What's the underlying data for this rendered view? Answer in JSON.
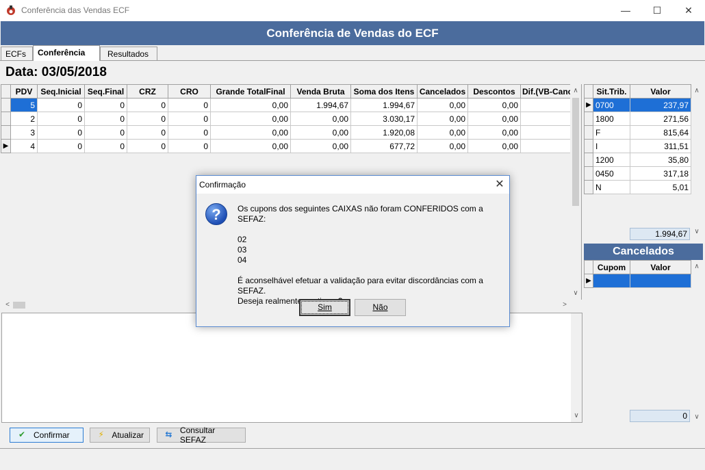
{
  "window": {
    "title": "Conferência das Vendas ECF",
    "minimize": "—",
    "maximize": "☐",
    "close": "✕"
  },
  "header": {
    "title": "Conferência de Vendas do ECF"
  },
  "tabs": [
    {
      "label": "ECFs"
    },
    {
      "label": "Conferência"
    },
    {
      "label": "Resultados"
    }
  ],
  "date_label": "Data: 03/05/2018",
  "main_grid": {
    "columns": [
      "PDV",
      "Seq.Inicial",
      "Seq.Final",
      "CRZ",
      "CRO",
      "Grande TotalFinal",
      "Venda Bruta",
      "Soma dos Itens",
      "Cancelados",
      "Descontos",
      "Dif.(VB-Canc"
    ],
    "rows": [
      [
        "5",
        "0",
        "0",
        "0",
        "0",
        "0,00",
        "1.994,67",
        "1.994,67",
        "0,00",
        "0,00",
        ""
      ],
      [
        "2",
        "0",
        "0",
        "0",
        "0",
        "0,00",
        "0,00",
        "3.030,17",
        "0,00",
        "0,00",
        ""
      ],
      [
        "3",
        "0",
        "0",
        "0",
        "0",
        "0,00",
        "0,00",
        "1.920,08",
        "0,00",
        "0,00",
        ""
      ],
      [
        "4",
        "0",
        "0",
        "0",
        "0",
        "0,00",
        "0,00",
        "677,72",
        "0,00",
        "0,00",
        ""
      ]
    ],
    "indicator_glyph": "▶"
  },
  "sit_grid": {
    "columns": [
      "Sit.Trib.",
      "Valor"
    ],
    "rows": [
      [
        "0700",
        "237,97"
      ],
      [
        "1800",
        "271,56"
      ],
      [
        "F",
        "815,64"
      ],
      [
        "I",
        "311,51"
      ],
      [
        "1200",
        "35,80"
      ],
      [
        "0450",
        "317,18"
      ],
      [
        "N",
        "5,01"
      ]
    ],
    "total": "1.994,67"
  },
  "cancel_panel": {
    "title": "Cancelados",
    "columns": [
      "Cupom",
      "Valor"
    ],
    "total": "0"
  },
  "buttons": {
    "confirmar": "Confirmar",
    "atualizar": "Atualizar",
    "consultar": "Consultar SEFAZ"
  },
  "icons": {
    "confirmar": "check-icon",
    "atualizar": "lightning-icon",
    "consultar": "arrows-icon"
  },
  "dialog": {
    "title": "Confirmação",
    "message_lines": [
      "Os cupons dos seguintes CAIXAS não foram CONFERIDOS com a SEFAZ:",
      "",
      "02",
      "03",
      "04",
      "",
      "É aconselhável efetuar a validação para evitar discordâncias com a SEFAZ.",
      "Deseja realmente continuar?"
    ],
    "yes_label": "Sim",
    "no_label": "Não",
    "icon_glyph": "?"
  },
  "colors": {
    "header_blue": "#4b6c9d",
    "selection_blue": "#1e6fd6",
    "total_field": "#dde8f3"
  }
}
